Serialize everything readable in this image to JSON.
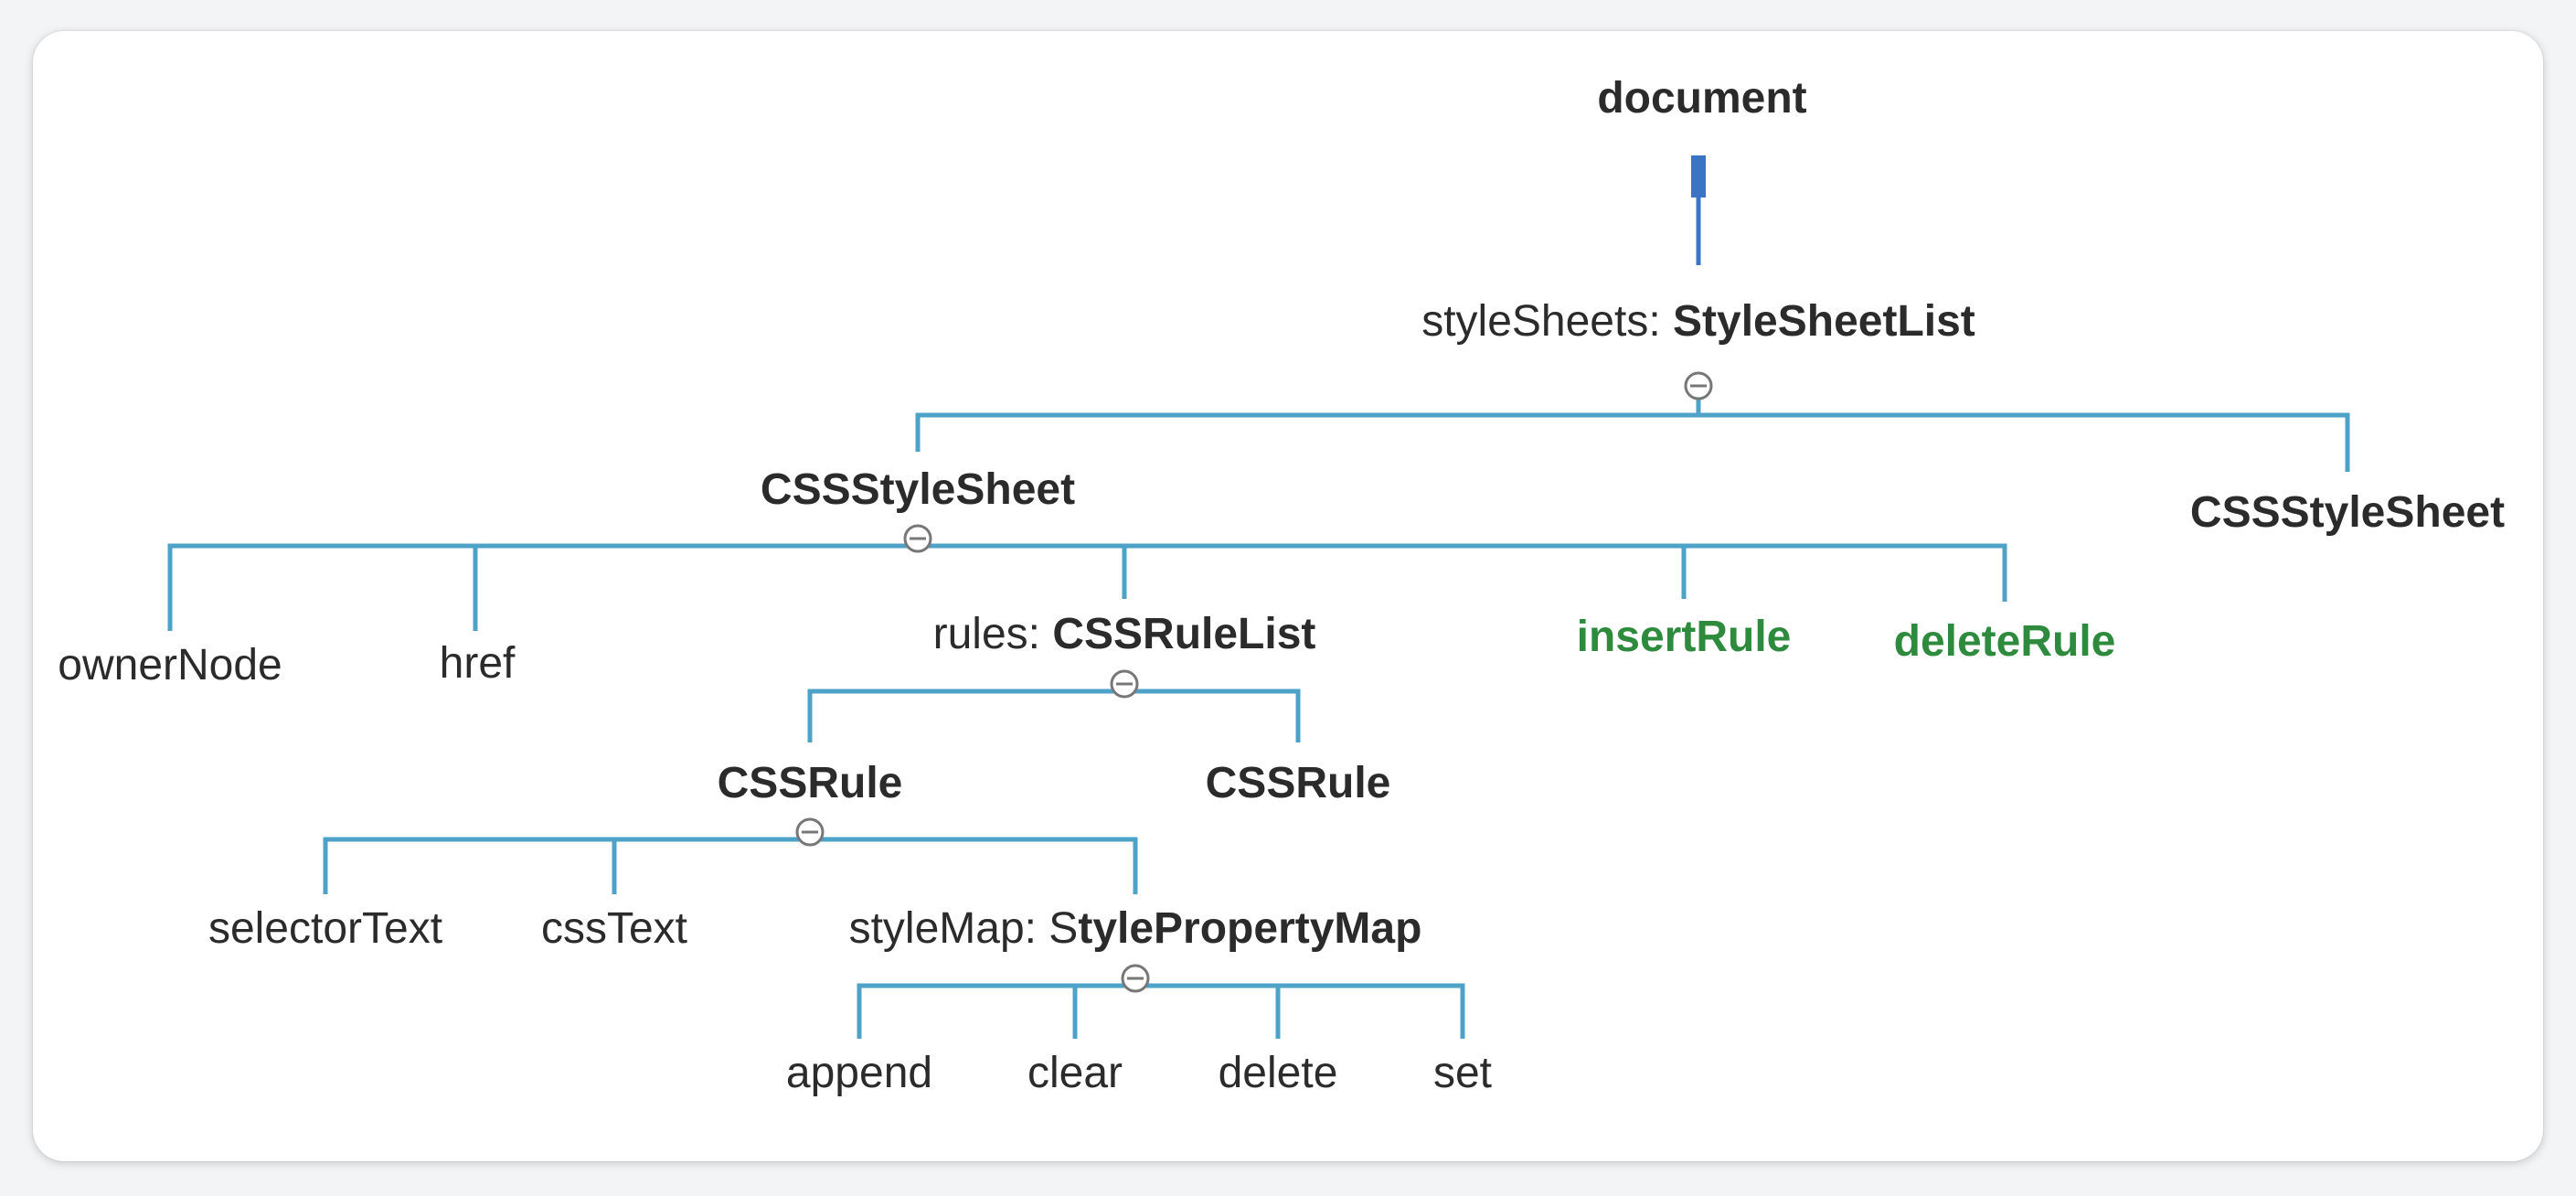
{
  "colors": {
    "connector": "#4ea1c7",
    "root_stem": "#3b74c4",
    "method_green": "#2e8b3e",
    "collapse_toggle": "#777777"
  },
  "diagram": {
    "root": "document",
    "stylesheets": {
      "prop": "styleSheets: ",
      "type": "StyleSheetList"
    },
    "sheet1": "CSSStyleSheet",
    "sheet2": "CSSStyleSheet",
    "owner_node": "ownerNode",
    "href": "href",
    "rules": {
      "prop": "rules: ",
      "type": "CSSRuleList"
    },
    "insert_rule": "insertRule",
    "delete_rule": "deleteRule",
    "rule1": "CSSRule",
    "rule2": "CSSRule",
    "selector_text": "selectorText",
    "css_text": "cssText",
    "style_map": {
      "prop": "styleMap: S",
      "type": "tylePropertyMap"
    },
    "append": "append",
    "clear": "clear",
    "delete": "delete",
    "set": "set"
  }
}
